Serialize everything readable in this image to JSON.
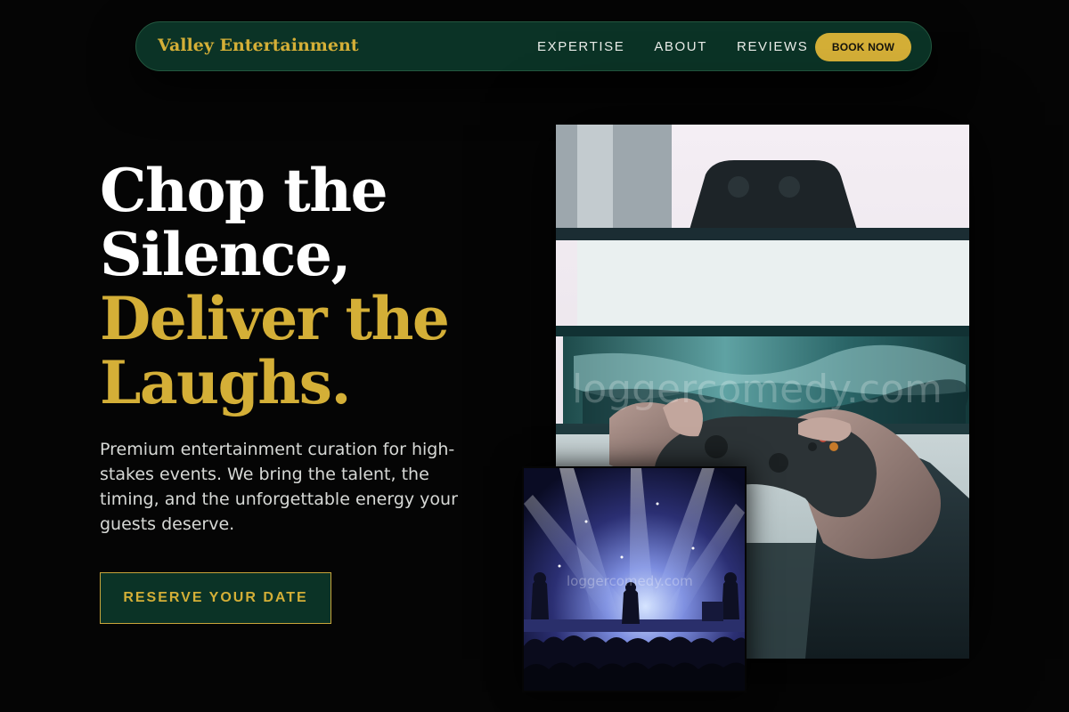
{
  "nav": {
    "brand": "Valley Entertainment",
    "links": [
      "EXPERTISE",
      "ABOUT",
      "REVIEWS"
    ],
    "cta": "BOOK NOW"
  },
  "hero": {
    "title_white": [
      "Chop the",
      "Silence,"
    ],
    "title_gold": [
      "Deliver the",
      "Laughs."
    ],
    "subtitle": "Premium entertainment curation for high-stakes events. We bring the talent, the timing, and the unforgettable energy your guests deserve.",
    "cta": "RESERVE YOUR DATE"
  },
  "images": {
    "main_watermark": "loggercomedy.com",
    "small_watermark": "loggercomedy.com"
  },
  "colors": {
    "background": "#050505",
    "nav_green": "#0b3326",
    "gold": "#d4af37",
    "text_white": "#ffffff",
    "text_muted": "#d7d9d6"
  }
}
